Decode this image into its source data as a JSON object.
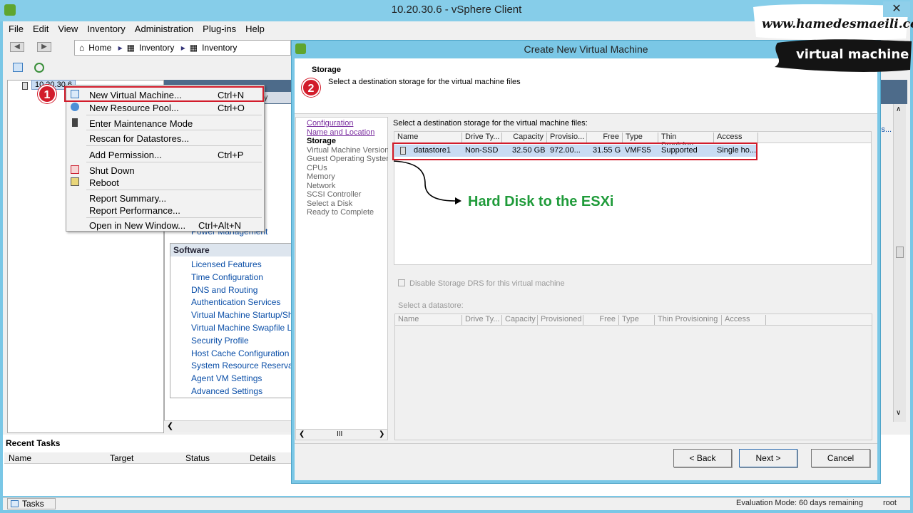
{
  "window": {
    "title": "10.20.30.6 - vSphere Client"
  },
  "menu": [
    "File",
    "Edit",
    "View",
    "Inventory",
    "Administration",
    "Plug-ins",
    "Help"
  ],
  "breadcrumb": {
    "home": "Home",
    "inventory1": "Inventory",
    "inventory2": "Inventory"
  },
  "tree": {
    "host": "10.20.30.6"
  },
  "summary": {
    "tab": "nary"
  },
  "context_menu": {
    "items": [
      {
        "label": "New Virtual Machine...",
        "shortcut": "Ctrl+N"
      },
      {
        "label": "New Resource Pool...",
        "shortcut": "Ctrl+O"
      },
      {
        "label": "Enter Maintenance Mode",
        "shortcut": ""
      },
      {
        "label": "Rescan for Datastores...",
        "shortcut": ""
      },
      {
        "label": "Add Permission...",
        "shortcut": "Ctrl+P"
      },
      {
        "label": "Shut Down",
        "shortcut": ""
      },
      {
        "label": "Reboot",
        "shortcut": ""
      },
      {
        "label": "Report Summary...",
        "shortcut": ""
      },
      {
        "label": "Report Performance...",
        "shortcut": ""
      },
      {
        "label": "Open in New Window...",
        "shortcut": "Ctrl+Alt+N"
      }
    ]
  },
  "badges": {
    "one": "1",
    "two": "2"
  },
  "software": {
    "power_management": "Power Management",
    "title": "Software",
    "items": [
      "Licensed Features",
      "Time Configuration",
      "DNS and Routing",
      "Authentication Services",
      "Virtual Machine Startup/Sh",
      "Virtual Machine Swapfile Lo",
      "Security Profile",
      "Host Cache Configuration",
      "System Resource Reserva",
      "Agent VM Settings",
      "Advanced Settings"
    ]
  },
  "recent_tasks": {
    "title": "Recent Tasks",
    "columns": [
      "Name",
      "Target",
      "Status",
      "Details"
    ]
  },
  "statusbar": {
    "tasks": "Tasks",
    "evaluation": "Evaluation Mode: 60 days remaining",
    "user": "root"
  },
  "dialog": {
    "title": "Create New Virtual Machine",
    "step_title": "Storage",
    "step_description": "Select a destination storage for the virtual machine files",
    "steps": [
      {
        "label": "Configuration",
        "state": "done"
      },
      {
        "label": "Name and Location",
        "state": "done"
      },
      {
        "label": "Storage",
        "state": "current"
      },
      {
        "label": "Virtual Machine Version",
        "state": "todo"
      },
      {
        "label": "Guest Operating System",
        "state": "todo"
      },
      {
        "label": "CPUs",
        "state": "todo"
      },
      {
        "label": "Memory",
        "state": "todo"
      },
      {
        "label": "Network",
        "state": "todo"
      },
      {
        "label": "SCSI Controller",
        "state": "todo"
      },
      {
        "label": "Select a Disk",
        "state": "todo"
      },
      {
        "label": "Ready to Complete",
        "state": "todo"
      }
    ],
    "select_label": "Select a destination storage for the virtual machine files:",
    "table_columns": [
      "Name",
      "Drive Ty...",
      "Capacity",
      "Provisio...",
      "Free",
      "Type",
      "Thin Provision...",
      "Access"
    ],
    "datastore_row": {
      "name": "datastore1",
      "drive_type": "Non-SSD",
      "capacity": "32.50 GB",
      "provisioned": "972.00...",
      "free": "31.55 G",
      "type": "VMFS5",
      "thin": "Supported",
      "access": "Single ho..."
    },
    "callout": "Hard Disk to the ESXi",
    "disable_drs": "Disable Storage DRS for this virtual machine",
    "select_datastore": "Select a datastore:",
    "table2_columns": [
      "Name",
      "Drive Ty...",
      "Capacity",
      "Provisioned",
      "Free",
      "Type",
      "Thin Provisioning",
      "Access"
    ],
    "buttons": {
      "back": "< Back",
      "next": "Next >",
      "cancel": "Cancel"
    }
  },
  "watermark": {
    "site": "www.hamedesmaeili.com",
    "tag": "virtual machine"
  },
  "right_panel": {
    "partial_link": "ls..."
  },
  "colors": {
    "highlight_red": "#d21c2b",
    "callout_green": "#1f9b3a",
    "titlebar": "#86cde9"
  }
}
